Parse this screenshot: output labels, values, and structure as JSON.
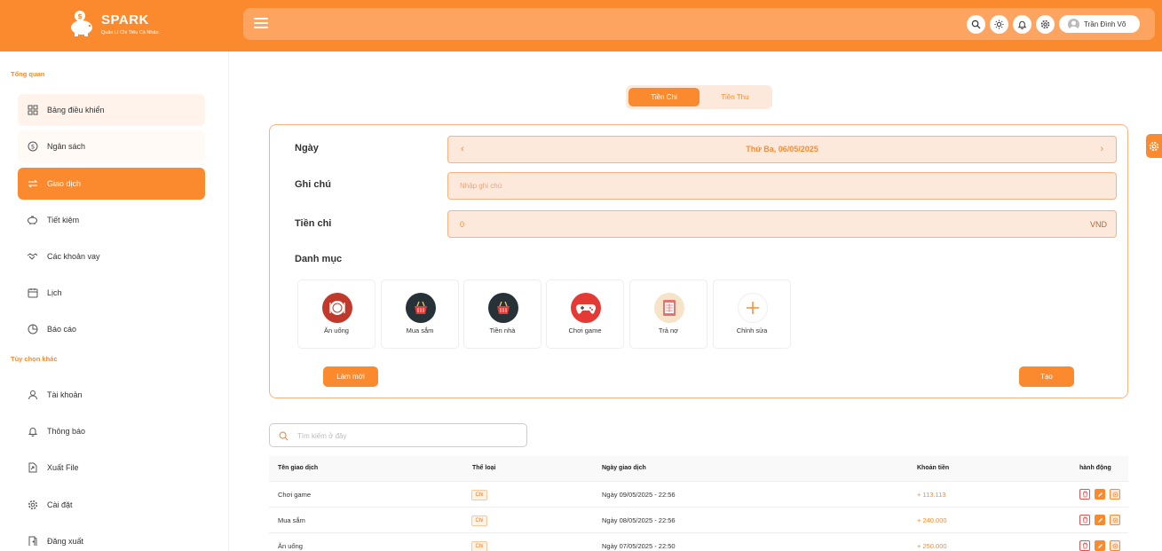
{
  "brand": {
    "name": "SPARK",
    "tagline": "Quản Lí Chi Tiêu Cá Nhân"
  },
  "header": {
    "user_name": "Trần Đình Võ",
    "icons": [
      "menu-icon",
      "search-icon",
      "sun-icon",
      "bell-icon",
      "gear-icon",
      "user-avatar-icon"
    ]
  },
  "sidebar": {
    "section_overview": "Tổng quan",
    "section_other": "Tùy chọn khác",
    "items": [
      {
        "label": "Bảng điều khiển",
        "icon": "grid-icon"
      },
      {
        "label": "Ngân sách",
        "icon": "dollar-circle-icon"
      },
      {
        "label": "Giao dịch",
        "icon": "transfer-icon"
      },
      {
        "label": "Tiết kiệm",
        "icon": "piggy-bank-icon"
      },
      {
        "label": "Các khoản vay",
        "icon": "handshake-icon"
      },
      {
        "label": "Lịch",
        "icon": "calendar-icon"
      },
      {
        "label": "Báo cáo",
        "icon": "pie-chart-icon"
      }
    ],
    "other_items": [
      {
        "label": "Tài khoản",
        "icon": "user-icon"
      },
      {
        "label": "Thông báo",
        "icon": "bell-icon"
      },
      {
        "label": "Xuất File",
        "icon": "export-file-icon"
      },
      {
        "label": "Cài đặt",
        "icon": "gear-icon"
      },
      {
        "label": "Đăng xuất",
        "icon": "door-icon"
      }
    ],
    "active": "Giao dịch"
  },
  "tabs": {
    "expense": "Tiền Chi",
    "income": "Tiền Thu",
    "selected": "Tiền Chi"
  },
  "form": {
    "date_label": "Ngày",
    "date_value": "Thứ Ba, 06/05/2025",
    "note_label": "Ghi chú",
    "note_placeholder": "Nhập ghi chú",
    "amount_label": "Tiền chi",
    "amount_value": "0",
    "amount_unit": "VND",
    "category_label": "Danh mục",
    "categories": [
      {
        "name": "Ăn uống",
        "icon": "dining-plate-icon",
        "color": "#c0392b"
      },
      {
        "name": "Mua sắm",
        "icon": "shopping-basket-icon",
        "color": "#263238"
      },
      {
        "name": "Tiền nhà",
        "icon": "house-basket-icon",
        "color": "#263238"
      },
      {
        "name": "Chơi game",
        "icon": "gamepad-icon",
        "color": "#e53935"
      },
      {
        "name": "Trả nợ",
        "icon": "bill-icon",
        "color": "#f6e3c8"
      },
      {
        "name": "Chỉnh sửa",
        "icon": "plus-icon",
        "color": "#ffffff"
      }
    ],
    "reset_label": "Làm mới",
    "create_label": "Tạo"
  },
  "search": {
    "placeholder": "Tìm kiếm ở đây"
  },
  "table": {
    "headers": [
      "Tên giao dịch",
      "Thể loại",
      "Ngày giao dịch",
      "Khoản tiền",
      "hành động"
    ],
    "rows": [
      {
        "name": "Chơi game",
        "type": "Chi",
        "date": "Ngày 09/05/2025 - 22:56",
        "amount": "+ 113.113"
      },
      {
        "name": "Mua sắm",
        "type": "Chi",
        "date": "Ngày 08/05/2025 - 22:56",
        "amount": "+ 240.000"
      },
      {
        "name": "Ăn uống",
        "type": "Chi",
        "date": "Ngày 07/05/2025 - 22:50",
        "amount": "+ 250.000"
      }
    ]
  },
  "colors": {
    "accent": "#fb8a2e",
    "accent_light": "#fde9dc",
    "header_bar": "#fda461"
  }
}
